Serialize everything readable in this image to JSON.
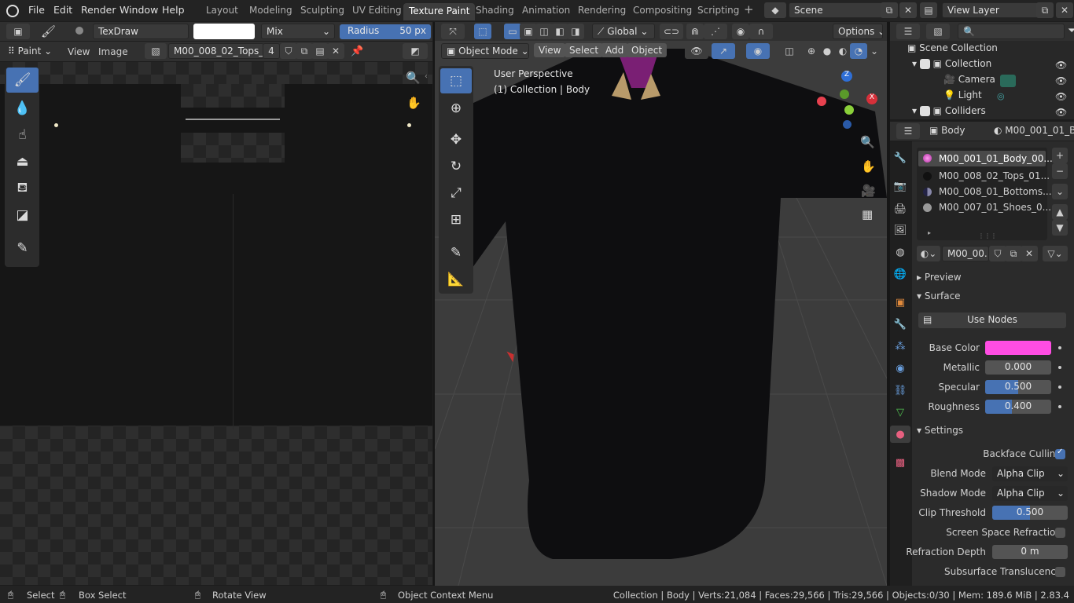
{
  "menu": {
    "items": [
      "File",
      "Edit",
      "Render",
      "Window",
      "Help"
    ]
  },
  "workspaces": {
    "tabs": [
      "Layout",
      "Modeling",
      "Sculpting",
      "UV Editing",
      "Texture Paint",
      "Shading",
      "Animation",
      "Rendering",
      "Compositing",
      "Scripting"
    ],
    "active": "Texture Paint"
  },
  "scene": {
    "name": "Scene",
    "view_layer": "View Layer"
  },
  "paint_header": {
    "brush": "TexDraw",
    "blend": "Mix",
    "radius_label": "Radius",
    "radius_value": "50 px"
  },
  "image_editor": {
    "mode": "Paint",
    "view_menu": "View",
    "image_menu": "Image",
    "image_name": "M00_008_02_Tops_...",
    "users": "4"
  },
  "viewport": {
    "orientation": "Global",
    "mode": "Object Mode",
    "menus": [
      "View",
      "Select",
      "Add",
      "Object"
    ],
    "options_label": "Options",
    "overlay_title": "User Perspective",
    "overlay_sub": "(1) Collection | Body"
  },
  "outliner": {
    "root": "Scene Collection",
    "rows": [
      {
        "name": "Collection"
      },
      {
        "name": "Camera"
      },
      {
        "name": "Light"
      },
      {
        "name": "Colliders"
      }
    ]
  },
  "properties": {
    "object_name": "Body",
    "material_path": "M00_001_01_B",
    "slots": [
      "M00_001_01_Body_00...",
      "M00_008_02_Tops_01...",
      "M00_008_01_Bottoms...",
      "M00_007_01_Shoes_0..."
    ],
    "material_field": "M00_00...",
    "panels": {
      "preview": "Preview",
      "surface": "Surface",
      "settings": "Settings"
    },
    "use_nodes": "Use Nodes",
    "base_color_label": "Base Color",
    "base_color": "#ff4de3",
    "metallic_label": "Metallic",
    "metallic": "0.000",
    "metallic_frac": 0.0,
    "specular_label": "Specular",
    "specular": "0.500",
    "specular_frac": 0.5,
    "roughness_label": "Roughness",
    "roughness": "0.400",
    "roughness_frac": 0.4,
    "backface_label": "Backface Culling",
    "blend_label": "Blend Mode",
    "blend": "Alpha Clip",
    "shadow_label": "Shadow Mode",
    "shadow": "Alpha Clip",
    "clip_label": "Clip Threshold",
    "clip": "0.500",
    "clip_frac": 0.5,
    "ssr_label": "Screen Space Refraction",
    "refr_label": "Refraction Depth",
    "refr": "0 m",
    "sss_label": "Subsurface Translucency"
  },
  "status": {
    "select": "Select",
    "box_select": "Box Select",
    "rotate": "Rotate View",
    "context": "Object Context Menu",
    "stats": "Collection | Body | Verts:21,084 | Faces:29,566 | Tris:29,566 | Objects:0/30 | Mem: 189.6 MiB | 2.83.4"
  },
  "colors": {
    "accent": "#4772b3",
    "active_material": "#ff4de3"
  }
}
